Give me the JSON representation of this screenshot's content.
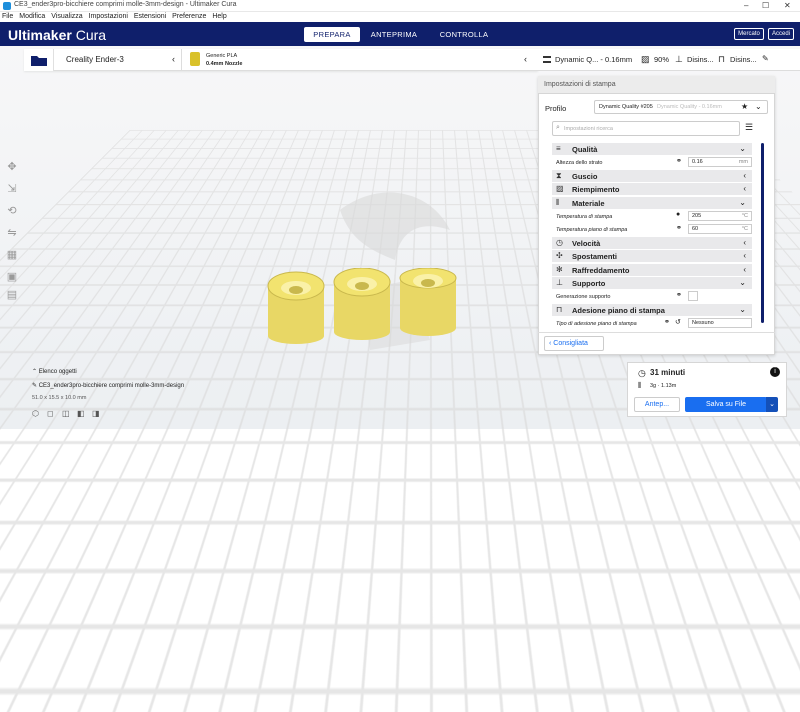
{
  "window": {
    "title": "CE3_ender3pro-bicchiere comprimi molle-3mm-design - Ultimaker Cura",
    "controls": [
      "–",
      "☐",
      "✕"
    ]
  },
  "menu": [
    "File",
    "Modifica",
    "Visualizza",
    "Impostazioni",
    "Estensioni",
    "Preferenze",
    "Help"
  ],
  "header": {
    "logo_main": "Ultimaker",
    "logo_sub": "Cura",
    "stages": [
      "PREPARA",
      "ANTEPRIMA",
      "CONTROLLA"
    ],
    "marketplace_label": "Mercato",
    "signin_label": "Accedi"
  },
  "machine": {
    "printer": "Creality Ender-3",
    "material": "Generic PLA",
    "nozzle": "0.4mm Nozzle"
  },
  "print_summary": {
    "profile": "Dynamic Q... - 0.16mm",
    "infill": "90%",
    "support": "Disins...",
    "adhesion": "Disins..."
  },
  "panel": {
    "title": "Impostazioni di stampa",
    "profile_label": "Profilo",
    "profile_value": "Dynamic Quality #205",
    "profile_hint": "Dynamic Quality - 0.16mm",
    "search_placeholder": "Impostazioni ricerca",
    "recommended_label": "Consigliata",
    "sections": [
      {
        "label": "Qualità",
        "icon": "quality-icon",
        "expanded": true
      },
      {
        "label": "Guscio",
        "icon": "shell-icon",
        "expanded": false
      },
      {
        "label": "Riempimento",
        "icon": "infill-icon",
        "expanded": false
      },
      {
        "label": "Materiale",
        "icon": "material-icon",
        "expanded": true
      },
      {
        "label": "Velocità",
        "icon": "speed-icon",
        "expanded": false
      },
      {
        "label": "Spostamenti",
        "icon": "travel-icon",
        "expanded": false
      },
      {
        "label": "Raffreddamento",
        "icon": "cooling-icon",
        "expanded": false
      },
      {
        "label": "Supporto",
        "icon": "support-icon",
        "expanded": true
      },
      {
        "label": "Adesione piano di stampa",
        "icon": "adhesion-icon",
        "expanded": true
      }
    ],
    "settings": {
      "layer_height_label": "Altezza dello strato",
      "layer_height_value": "0.16",
      "layer_height_unit": "mm",
      "print_temp_label": "Temperatura di stampa",
      "print_temp_value": "205",
      "print_temp_unit": "°C",
      "bed_temp_label": "Temperatura piano di stampa",
      "bed_temp_value": "60",
      "bed_temp_unit": "°C",
      "support_label": "Generazione supporto",
      "adhesion_type_label": "Tipo di adesione piano di stampa",
      "adhesion_type_value": "Nessuno"
    }
  },
  "objects": {
    "list_label": "Elenco oggetti",
    "name": "CE3_ender3pro-bicchiere comprimi molle-3mm-design",
    "dims": "51.0 x 15.5 x 10.0 mm"
  },
  "estimate": {
    "time": "31 minuti",
    "material": "3g · 1.13m",
    "preview_label": "Antep...",
    "save_label": "Salva su File"
  },
  "colors": {
    "header_bg": "#0f1f6b",
    "accent": "#196ef0",
    "model_fill": "#f2e36f"
  }
}
